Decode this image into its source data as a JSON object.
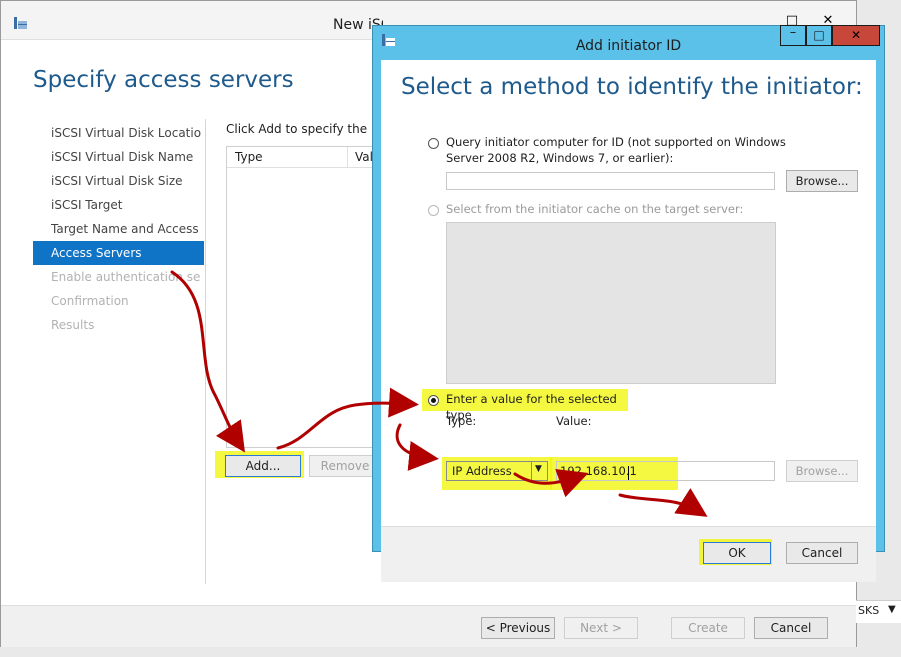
{
  "wizard": {
    "title": "New iSCSI Virtual Disk Wizard",
    "heading": "Specify access servers",
    "nav": [
      {
        "label": "iSCSI Virtual Disk Location",
        "state": "normal"
      },
      {
        "label": "iSCSI Virtual Disk Name",
        "state": "normal"
      },
      {
        "label": "iSCSI Virtual Disk Size",
        "state": "normal"
      },
      {
        "label": "iSCSI Target",
        "state": "normal"
      },
      {
        "label": "Target Name and Access",
        "state": "normal"
      },
      {
        "label": "Access Servers",
        "state": "selected"
      },
      {
        "label": "Enable authentication ser...",
        "state": "disabled"
      },
      {
        "label": "Confirmation",
        "state": "disabled"
      },
      {
        "label": "Results",
        "state": "disabled"
      }
    ],
    "instruction": "Click Add to specify the iSCSI",
    "list_columns": [
      "Type",
      "Valu"
    ],
    "add_label": "Add...",
    "remove_label": "Remove",
    "previous_label": "< Previous",
    "next_label": "Next >",
    "create_label": "Create",
    "cancel_label": "Cancel",
    "side_fragment": "SKS"
  },
  "dialog": {
    "title": "Add initiator ID",
    "heading": "Select a method to identify the initiator:",
    "option1_line1": "Query initiator computer for ID (not supported on Windows",
    "option1_line2": "Server 2008 R2, Windows 7, or earlier):",
    "option1_browse": "Browse...",
    "option2_label": "Select from the initiator cache on the target server:",
    "option3_label": "Enter a value for the selected type",
    "type_label": "Type:",
    "value_label": "Value:",
    "type_selected": "IP Address",
    "value": "192.168.10.1",
    "value_browse": "Browse...",
    "ok_label": "OK",
    "cancel_label": "Cancel"
  },
  "colors": {
    "accent": "#0f73c6",
    "dialog_frame": "#5bc1e8",
    "highlight": "#f2f600",
    "annotation_arrow": "#b00000"
  }
}
